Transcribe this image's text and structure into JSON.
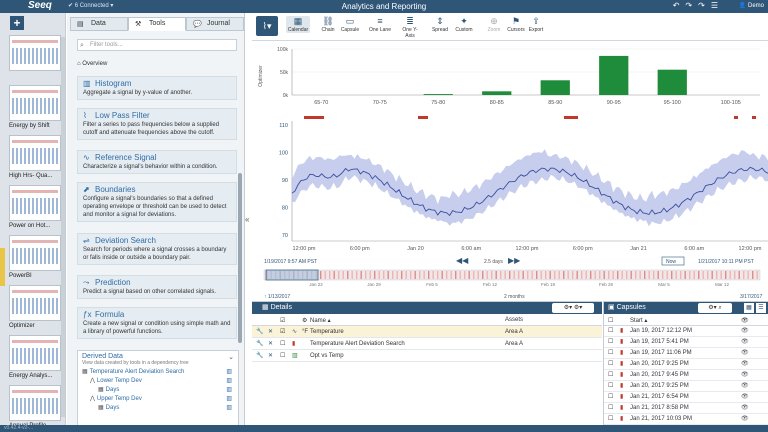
{
  "topbar": {
    "logo": "Seeq",
    "connected": "6 Connected",
    "title": "Analytics and Reporting",
    "user": "Demo"
  },
  "worksheets": [
    {
      "label": ""
    },
    {
      "label": "Energy by Shift"
    },
    {
      "label": "High Hrs- Qua..."
    },
    {
      "label": "Power on Hot..."
    },
    {
      "label": "PowerBI"
    },
    {
      "label": "Optimizer"
    },
    {
      "label": "Energy Analys..."
    },
    {
      "label": "Annual Profile"
    }
  ],
  "tabs": {
    "data": "Data",
    "tools": "Tools",
    "journal": "Journal"
  },
  "filter_placeholder": "Filter tools...",
  "overview": "Overview",
  "tools": [
    {
      "title": "Histogram",
      "desc": "Aggregate a signal by y-value of another.",
      "icon": "histogram-icon"
    },
    {
      "title": "Low Pass Filter",
      "desc": "Filter a series to pass frequencies below a supplied cutoff and attenuate frequencies above the cutoff.",
      "icon": "filter-icon"
    },
    {
      "title": "Reference Signal",
      "desc": "Characterize a signal's behavior within a condition.",
      "icon": "reference-icon"
    },
    {
      "title": "Boundaries",
      "desc": "Configure a signal's boundaries so that a defined operating envelope or threshold can be used to detect and monitor a signal for deviations.",
      "icon": "boundaries-icon"
    },
    {
      "title": "Deviation Search",
      "desc": "Search for periods where a signal crosses a boundary or falls inside or outside a boundary pair.",
      "icon": "deviation-icon"
    },
    {
      "title": "Prediction",
      "desc": "Predict a signal based on other correlated signals.",
      "icon": "prediction-icon"
    },
    {
      "title": "Formula",
      "desc": "Create a new signal or condition using simple math and a library of powerful functions.",
      "icon": "formula-icon"
    }
  ],
  "derived": {
    "title": "Derived Data",
    "subtitle": "View data created by tools in a dependency tree",
    "tree": [
      {
        "label": "Temperature Alert Deviation Search",
        "indent": 0
      },
      {
        "label": "Lower Temp Dev",
        "indent": 1
      },
      {
        "label": "Days",
        "indent": 2
      },
      {
        "label": "Upper Temp Dev",
        "indent": 1
      },
      {
        "label": "Days",
        "indent": 2
      }
    ]
  },
  "toolbar": {
    "buttons": [
      {
        "label": "Calendar",
        "icon": "▦",
        "state": "sel"
      },
      {
        "label": "Chain",
        "icon": "⛓",
        "state": ""
      },
      {
        "label": "Capsule",
        "icon": "▭",
        "state": ""
      },
      {
        "label": "One Lane",
        "icon": "≡",
        "state": ""
      },
      {
        "label": "One Y-Axis",
        "icon": "≣",
        "state": ""
      },
      {
        "label": "Spread",
        "icon": "⇕",
        "state": ""
      },
      {
        "label": "Custom",
        "icon": "✦",
        "state": ""
      },
      {
        "label": "Zoom",
        "icon": "⊕",
        "state": "off"
      },
      {
        "label": "Cursors",
        "icon": "⚑",
        "state": ""
      },
      {
        "label": "Export",
        "icon": "⇪",
        "state": ""
      }
    ]
  },
  "chart_data": {
    "type": "bar",
    "ylabel": "Optimizer",
    "yticks": [
      "100k",
      "50k",
      "0k"
    ],
    "ylim": [
      0,
      100000
    ],
    "categories": [
      "65-70",
      "70-75",
      "75-80",
      "80-85",
      "85-90",
      "90-95",
      "95-100",
      "100-105"
    ],
    "values": [
      0,
      0,
      2000,
      8000,
      32000,
      85000,
      55000,
      0
    ]
  },
  "trend": {
    "yticks": [
      "110",
      "100",
      "90",
      "80",
      "70"
    ],
    "xticks": [
      "12:00 pm",
      "6:00 pm",
      "Jan 20",
      "6:00 am",
      "12:00 pm",
      "6:00 pm",
      "Jan 21",
      "6:00 am",
      "12:00 pm"
    ],
    "start": "1/19/2017 9:57 AM PST",
    "end": "1/21/2017 10:11 PM PST",
    "duration": "2.5 days",
    "now": "Now",
    "overview_start": "1/13/2017",
    "overview_end": "3/17/2017",
    "overview_duration": "2 months",
    "overview_ticks": [
      "Jan 22",
      "Jan 29",
      "Feb 5",
      "Feb 12",
      "Feb 19",
      "Feb 26",
      "Mar 5",
      "Mar 12"
    ]
  },
  "details": {
    "title": "Details",
    "col_name": "Name",
    "col_assets": "Assets",
    "rows": [
      {
        "name": "Temperature",
        "asset": "Area A",
        "hl": true,
        "unit": "°F"
      },
      {
        "name": "Temperature Alert Deviation Search",
        "asset": "Area A",
        "hl": false,
        "unit": ""
      },
      {
        "name": "Opt vs Temp",
        "asset": "",
        "hl": false,
        "unit": ""
      }
    ]
  },
  "capsules": {
    "title": "Capsules",
    "col_start": "Start",
    "rows": [
      "Jan 19, 2017 12:12 PM",
      "Jan 19, 2017 5:41 PM",
      "Jan 19, 2017 11:06 PM",
      "Jan 20, 2017 9:25 PM",
      "Jan 20, 2017 9:45 PM",
      "Jan 20, 2017 9:25 PM",
      "Jan 21, 2017 6:54 PM",
      "Jan 21, 2017 8:58 PM",
      "Jan 21, 2017 10:03 PM"
    ]
  },
  "status": "v0.42.4-v2-..."
}
